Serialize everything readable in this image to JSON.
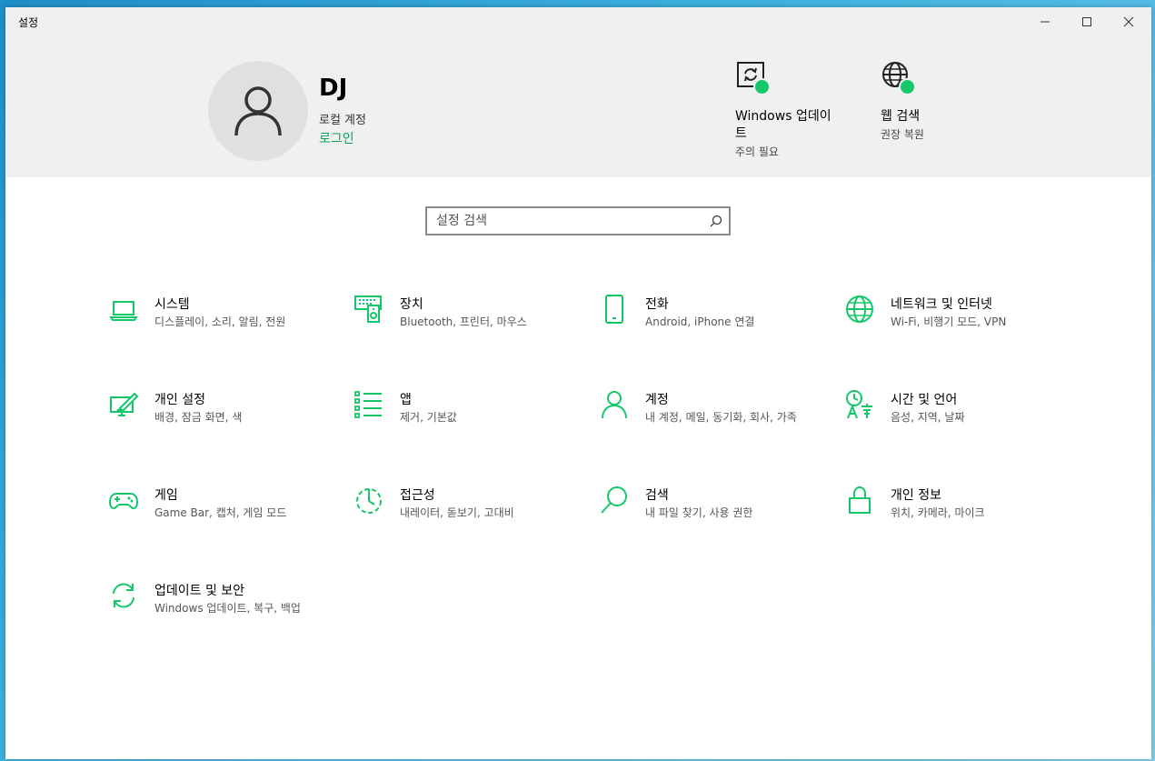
{
  "window": {
    "title": "설정"
  },
  "user": {
    "name": "DJ",
    "account_type": "로컬 계정",
    "login_link": "로그인"
  },
  "quick_items": [
    {
      "title": "Windows 업데이트",
      "subtitle": "주의 필요",
      "icon": "windows-update-icon"
    },
    {
      "title": "웹 검색",
      "subtitle": "권장 복원",
      "icon": "globe-icon"
    }
  ],
  "search": {
    "placeholder": "설정 검색"
  },
  "colors": {
    "accent": "#14c86a",
    "link": "#0aa34f",
    "header_bg": "#f0f0f0"
  },
  "tiles": [
    {
      "name": "시스템",
      "desc": "디스플레이, 소리, 알림, 전원",
      "icon": "laptop-icon"
    },
    {
      "name": "장치",
      "desc": "Bluetooth, 프린터, 마우스",
      "icon": "devices-icon"
    },
    {
      "name": "전화",
      "desc": "Android, iPhone 연결",
      "icon": "phone-icon"
    },
    {
      "name": "네트워크 및 인터넷",
      "desc": "Wi-Fi, 비행기 모드, VPN",
      "icon": "globe-icon"
    },
    {
      "name": "개인 설정",
      "desc": "배경, 잠금 화면, 색",
      "icon": "personalization-icon"
    },
    {
      "name": "앱",
      "desc": "제거, 기본값",
      "icon": "apps-list-icon"
    },
    {
      "name": "계정",
      "desc": "내 계정, 메일, 동기화, 회사, 가족",
      "icon": "person-icon"
    },
    {
      "name": "시간 및 언어",
      "desc": "음성, 지역, 날짜",
      "icon": "time-language-icon"
    },
    {
      "name": "게임",
      "desc": "Game Bar, 캡처, 게임 모드",
      "icon": "gamepad-icon"
    },
    {
      "name": "접근성",
      "desc": "내레이터, 돋보기, 고대비",
      "icon": "accessibility-icon"
    },
    {
      "name": "검색",
      "desc": "내 파일 찾기, 사용 권한",
      "icon": "search-icon"
    },
    {
      "name": "개인 정보",
      "desc": "위치, 카메라, 마이크",
      "icon": "lock-icon"
    },
    {
      "name": "업데이트 및 보안",
      "desc": "Windows 업데이트, 복구, 백업",
      "icon": "sync-icon"
    }
  ]
}
